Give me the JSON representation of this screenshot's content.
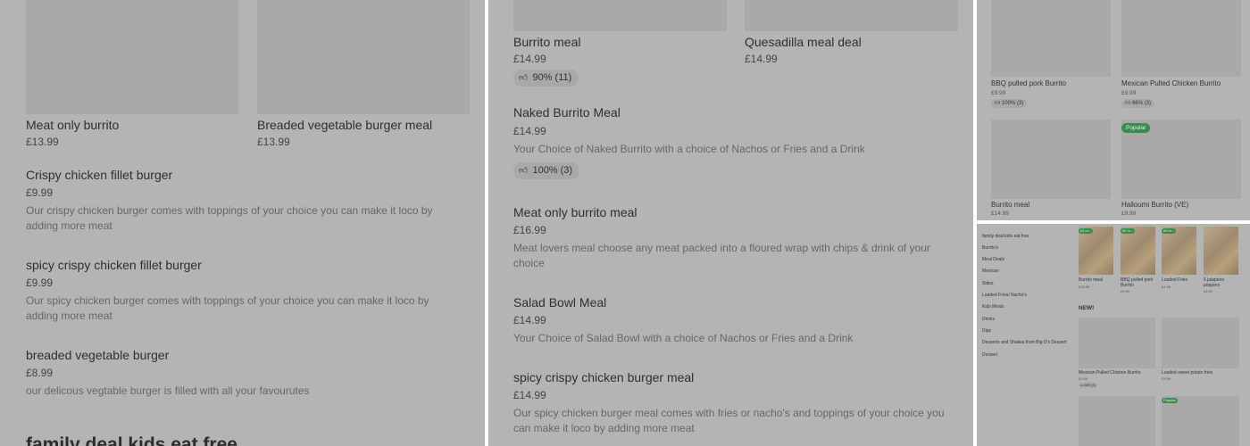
{
  "panel1": {
    "cards": [
      {
        "title": "Meat only burrito",
        "price": "£13.99"
      },
      {
        "title": "Breaded vegetable burger meal",
        "price": "£13.99"
      }
    ],
    "items": [
      {
        "title": "Crispy chicken fillet burger",
        "price": "£9.99",
        "desc_lines": [
          "Our crispy chicken burger comes with toppings of your choice you can make it loco by",
          "adding more meat"
        ]
      },
      {
        "title": "spicy crispy chicken fillet burger",
        "price": "£9.99",
        "desc_lines": [
          "Our spicy chicken burger comes with toppings of your choice you can make it loco by",
          "adding more meat"
        ]
      },
      {
        "title": "breaded vegetable burger",
        "price": "£8.99",
        "desc_lines": [
          "our delicous vegtable burger is filled with all your favourutes"
        ]
      }
    ],
    "section_title": "family deal kids eat free"
  },
  "panel2": {
    "cards": [
      {
        "title": " Burrito meal",
        "price": "£14.99",
        "rating": "90% (11)"
      },
      {
        "title": "Quesadilla meal deal",
        "price": "£14.99"
      }
    ],
    "items": [
      {
        "title": "Naked Burrito Meal",
        "price": "£14.99",
        "desc_lines": [
          "Your Choice of Naked Burrito with a choice of Nachos or Fries and a Drink"
        ],
        "rating": "100% (3)"
      },
      {
        "title": "Meat only burrito meal",
        "price": "£16.99",
        "desc_lines": [
          "Meat lovers meal choose any meat packed into a floured wrap with chips & drink of your",
          "choice"
        ]
      },
      {
        "title": "Salad Bowl Meal",
        "price": "£14.99",
        "desc_lines": [
          "Your Choice of Salad Bowl with a choice of Nachos or Fries and a Drink"
        ]
      },
      {
        "title": "spicy crispy chicken burger meal",
        "price": "£14.99",
        "desc_lines": [
          "Our spicy chicken burger meal comes with fries or nacho's and toppings of your choice you",
          "can make it loco by adding more meat"
        ]
      }
    ]
  },
  "panel3": {
    "cards": [
      {
        "title": "BBQ pulled pork Burrito",
        "price": "£9.99",
        "rating": "100% (3)"
      },
      {
        "title": "Mexican Pulled Chicken Burrito",
        "price": "£9.99",
        "rating": "66% (3)"
      },
      {
        "title": " Burrito meal",
        "price": "£14.99"
      },
      {
        "title": "Halloumi Burrito (VE)",
        "price": "£9.99",
        "badge": "Popular"
      }
    ]
  },
  "panel4": {
    "nav": [
      "family deal kids eat free",
      "Burrito's",
      "Meal Deals",
      "Mexican",
      "Sides",
      "Loaded Fries/ Nacho's",
      "Kids Meals",
      "Drinks",
      "Dips",
      "Desserts and Shakes from Big D's Dessert",
      "Dessert"
    ],
    "top_cards": [
      {
        "title": " Burrito meal",
        "price": "£14.99",
        "badge": "#1 m..."
      },
      {
        "title": "BBQ pulled pork Burrito",
        "price": "£9.99",
        "badge": "#2 m..."
      },
      {
        "title": "Loaded Fries",
        "price": "£4.99",
        "badge": "#3 m..."
      },
      {
        "title": "6 jalapeno poppers",
        "price": "£5.99"
      }
    ],
    "section_title": "NEW!",
    "new_cards": [
      {
        "title": "Mexican Pulled Chicken Burrito",
        "price": "£9.99",
        "rating": "66% (3)"
      },
      {
        "title": "Loaded  sweet potato fries",
        "price": "£5.99"
      }
    ],
    "bottom_badge": "Popular"
  },
  "icons": {
    "rating": "thumbs-up-icon"
  }
}
